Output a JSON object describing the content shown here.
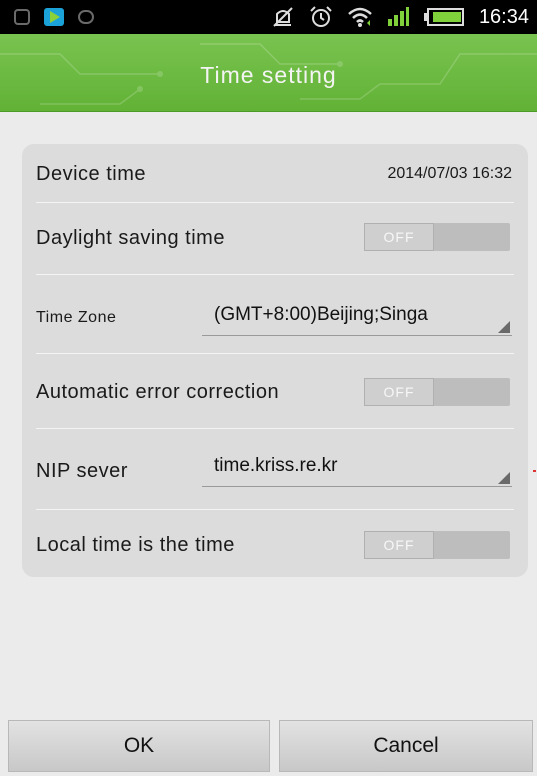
{
  "status_bar": {
    "time": "16:34",
    "icons": [
      "notification-icon",
      "play-store-icon",
      "notification-icon-2",
      "mute-icon",
      "alarm-icon",
      "wifi-icon",
      "signal-icon",
      "battery-icon"
    ],
    "signal_color": "#7fd03a",
    "battery_color": "#7fd03a"
  },
  "header": {
    "title": "Time setting",
    "color": "#6cb843"
  },
  "settings": {
    "device_time": {
      "label": "Device time",
      "value": "2014/07/03 16:32"
    },
    "daylight_saving": {
      "label": "Daylight saving time",
      "state": "OFF"
    },
    "time_zone": {
      "label": "Time Zone",
      "value": "(GMT+8:00)Beijing;Singa"
    },
    "auto_correction": {
      "label": "Automatic error correction",
      "state": "OFF"
    },
    "ntp_server": {
      "label": "NIP sever",
      "value": "time.kriss.re.kr"
    },
    "local_time": {
      "label": "Local time is the time",
      "state": "OFF"
    }
  },
  "buttons": {
    "ok": "OK",
    "cancel": "Cancel"
  }
}
